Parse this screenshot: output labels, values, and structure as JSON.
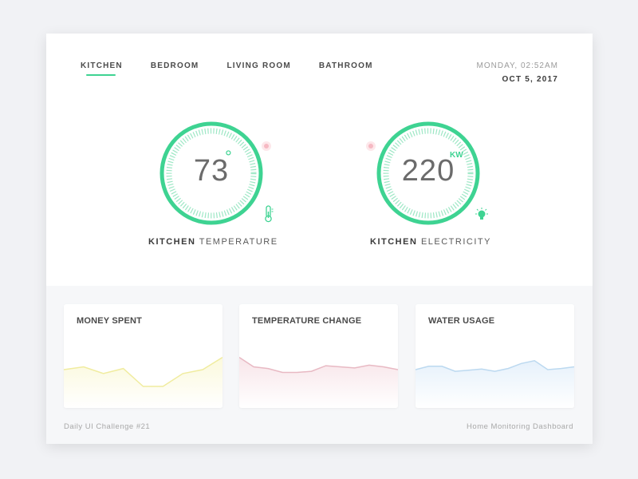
{
  "nav": {
    "tabs": [
      {
        "label": "KITCHEN",
        "active": true
      },
      {
        "label": "BEDROOM",
        "active": false
      },
      {
        "label": "LIVING ROOM",
        "active": false
      },
      {
        "label": "BATHROOM",
        "active": false
      }
    ]
  },
  "datetime": {
    "day_time": "MONDAY, 02:52AM",
    "date": "OCT 5, 2017"
  },
  "gauges": [
    {
      "value": "73",
      "unit_symbol": "°",
      "label_bold": "KITCHEN",
      "label_rest": " TEMPERATURE",
      "icon": "thermometer-icon"
    },
    {
      "value": "220",
      "unit": "KW",
      "label_bold": "KITCHEN",
      "label_rest": " ELECTRICITY",
      "icon": "lightbulb-icon"
    }
  ],
  "panels": [
    {
      "title": "MONEY SPENT",
      "color": "#f0ec9f",
      "fill": "#fbf9dc",
      "values": [
        40,
        45,
        33,
        42,
        10,
        10,
        33,
        40,
        62
      ]
    },
    {
      "title": "TEMPERATURE CHANGE",
      "color": "#e8b9c3",
      "fill": "#f8e5e9",
      "values": [
        62,
        45,
        42,
        35,
        35,
        37,
        47,
        45,
        43,
        48,
        45,
        40
      ]
    },
    {
      "title": "WATER USAGE",
      "color": "#bcd9f0",
      "fill": "#e6f1fb",
      "values": [
        40,
        46,
        46,
        37,
        39,
        41,
        37,
        42,
        51,
        56,
        40,
        42,
        45
      ]
    }
  ],
  "footer": {
    "left": "Daily UI Challenge #21",
    "right": "Home Monitoring Dashboard"
  },
  "colors": {
    "accent": "#3ed392",
    "background": "#f1f2f5"
  }
}
